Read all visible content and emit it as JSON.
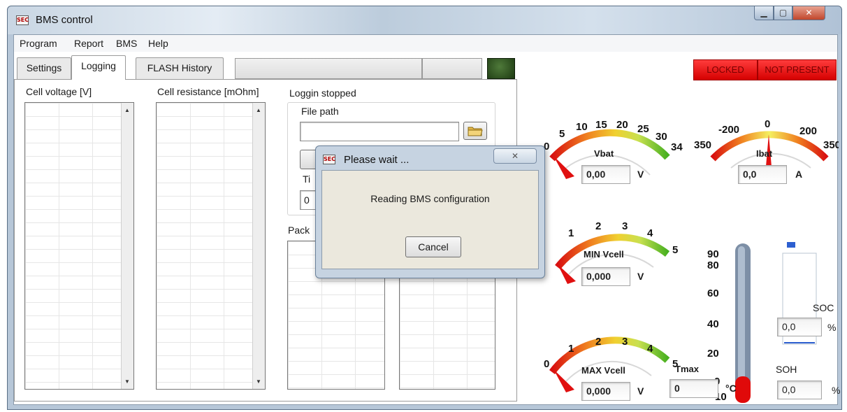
{
  "window": {
    "title": "BMS control",
    "app_icon_text": "SEC"
  },
  "menu": {
    "items": [
      "Program",
      "Report",
      "BMS",
      "Help"
    ]
  },
  "tabs": {
    "settings": "Settings",
    "logging": "Logging",
    "flash_history": "FLASH History"
  },
  "logging": {
    "cell_voltage_label": "Cell voltage [V]",
    "cell_resistance_label": "Cell resistance [mOhm]",
    "status_text": "Loggin stopped",
    "file_path_label": "File path",
    "file_path_value": "",
    "partial_label_t": "Ti",
    "partial_value_zero": "0",
    "partial_pack_label": "Pack"
  },
  "indicators": {
    "locked": "LOCKED",
    "not_present": "NOT PRESENT"
  },
  "gauges": {
    "vbat": {
      "label": "Vbat",
      "value": "0,00",
      "unit": "V",
      "ticks": [
        "0",
        "5",
        "10",
        "15",
        "20",
        "25",
        "30",
        "34"
      ]
    },
    "ibat": {
      "label": "Ibat",
      "value": "0,0",
      "unit": "A",
      "ticks": [
        "350",
        "-200",
        "0",
        "200",
        "350"
      ]
    },
    "min_vcell": {
      "label": "MIN Vcell",
      "value": "0,000",
      "unit": "V",
      "ticks": [
        "1",
        "2",
        "3",
        "4",
        "5"
      ]
    },
    "max_vcell": {
      "label": "MAX Vcell",
      "value": "0,000",
      "unit": "V",
      "ticks": [
        "0",
        "1",
        "2",
        "3",
        "4",
        "5"
      ]
    }
  },
  "thermometer": {
    "ticks": [
      "90",
      "80",
      "60",
      "40",
      "20",
      "0",
      "-10"
    ],
    "label": "Tmax",
    "value": "0",
    "unit": "°C"
  },
  "soc": {
    "label": "SOC",
    "value": "0,0",
    "unit": "%",
    "level": 0
  },
  "soh": {
    "label": "SOH",
    "value": "0,0",
    "unit": "%"
  },
  "dialog": {
    "title": "Please wait ...",
    "message": "Reading BMS configuration",
    "cancel_label": "Cancel",
    "close_glyph": "✕"
  },
  "colors": {
    "indicator_red": "#e80000",
    "led_green": "#1f4a12"
  }
}
